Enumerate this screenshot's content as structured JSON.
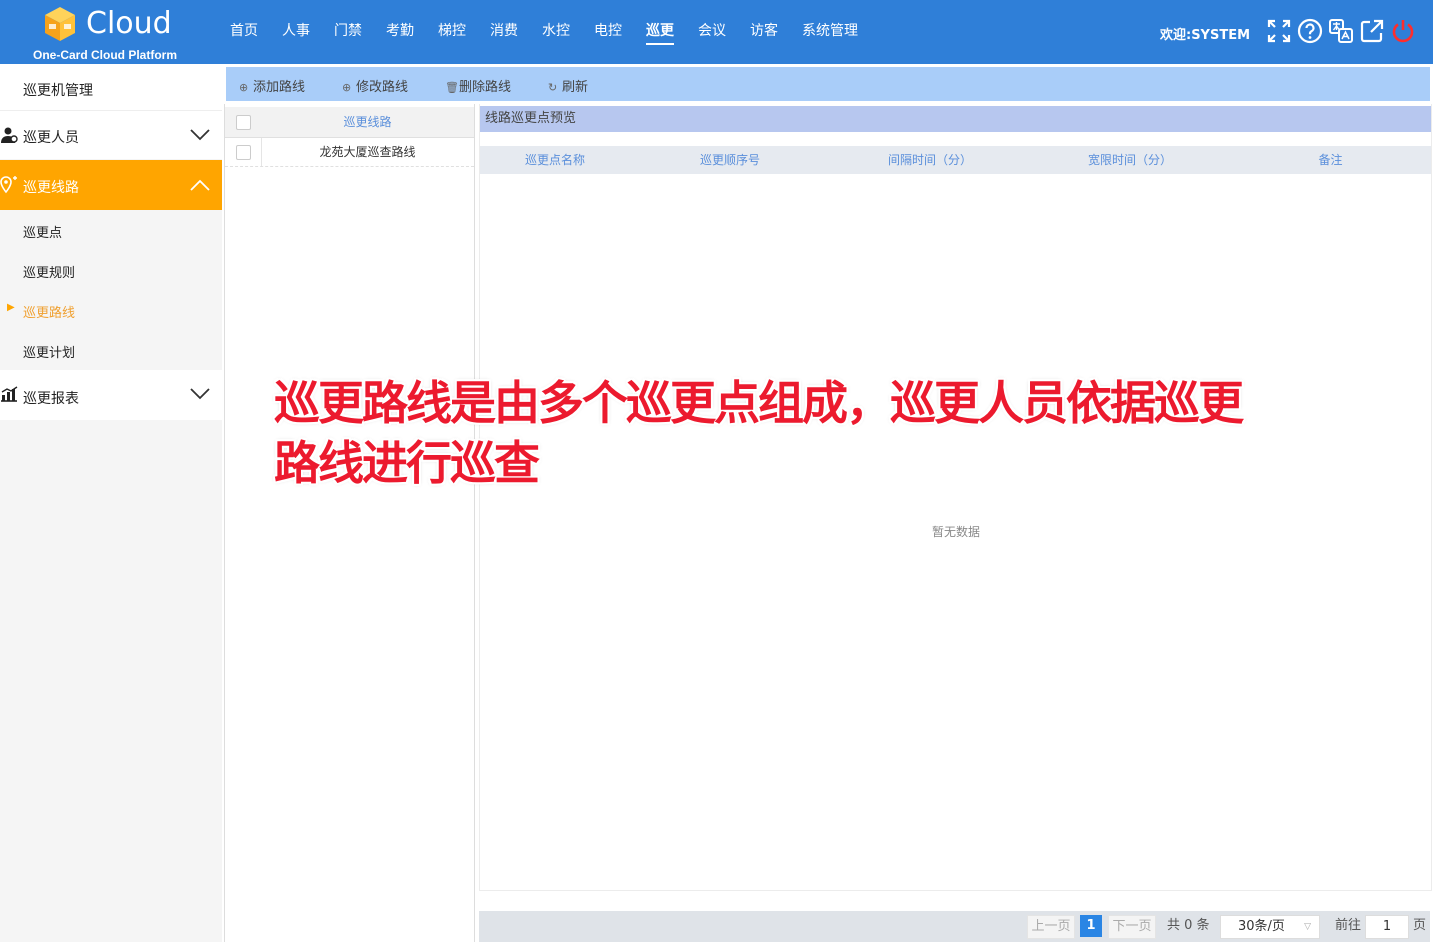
{
  "header": {
    "logo_title": "Cloud",
    "logo_subtitle": "One-Card Cloud Platform",
    "nav": [
      {
        "label": "首页"
      },
      {
        "label": "人事"
      },
      {
        "label": "门禁"
      },
      {
        "label": "考勤"
      },
      {
        "label": "梯控"
      },
      {
        "label": "消费"
      },
      {
        "label": "水控"
      },
      {
        "label": "电控"
      },
      {
        "label": "巡更",
        "active": true
      },
      {
        "label": "会议"
      },
      {
        "label": "访客"
      },
      {
        "label": "系统管理"
      }
    ],
    "welcome": "欢迎:SYSTEM",
    "icons": [
      "fullscreen-icon",
      "help-icon",
      "language-icon",
      "external-link-icon",
      "power-icon"
    ],
    "accent_color": "#2f7fd8"
  },
  "sidebar": {
    "patrol_machine": "巡更机管理",
    "patrol_staff": "巡更人员",
    "patrol_route": "巡更线路",
    "submenu": [
      {
        "label": "巡更点"
      },
      {
        "label": "巡更规则"
      },
      {
        "label": "巡更路线",
        "active": true
      },
      {
        "label": "巡更计划"
      }
    ],
    "patrol_report": "巡更报表",
    "active_color": "#ffa500"
  },
  "toolbar": {
    "add": "添加路线",
    "edit": "修改路线",
    "delete": "删除路线",
    "refresh": "刷新"
  },
  "route_list": {
    "header": "巡更线路",
    "rows": [
      "龙苑大厦巡查路线"
    ]
  },
  "preview": {
    "title": "线路巡更点预览",
    "columns": [
      "巡更点名称",
      "巡更顺序号",
      "间隔时间（分）",
      "宽限时间（分）",
      "备注"
    ],
    "empty_text": "暂无数据"
  },
  "pagination": {
    "prev": "上一页",
    "current": "1",
    "next": "下一页",
    "total": "共 0 条",
    "page_size": "30条/页",
    "goto_label": "前往",
    "goto_value": "1",
    "page_suffix": "页"
  },
  "annotation": {
    "line1": "巡更路线是由多个巡更点组成，巡更人员依据巡更",
    "line2": "路线进行巡查"
  }
}
